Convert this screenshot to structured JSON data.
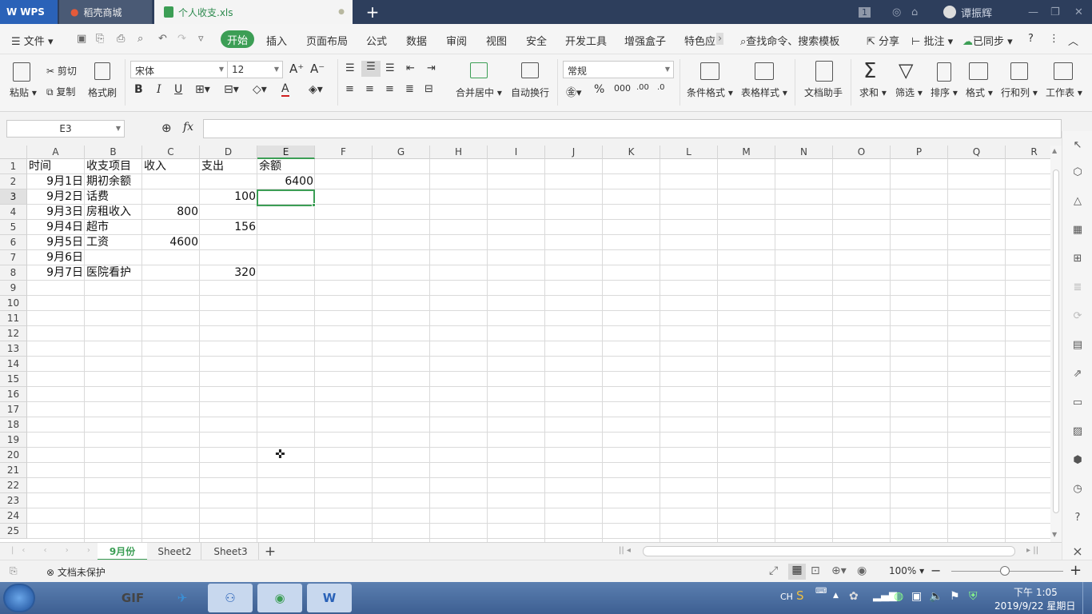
{
  "titlebar": {
    "app_tab": "WPS",
    "store_tab": "稻壳商城",
    "file_tab": "个人收支.xls",
    "new_tab_label": "+",
    "page_indicator": "1",
    "user_name": "谭振辉"
  },
  "menu": {
    "file": "文件",
    "items": [
      "开始",
      "插入",
      "页面布局",
      "公式",
      "数据",
      "审阅",
      "视图",
      "安全",
      "开发工具",
      "增强盒子",
      "特色应"
    ],
    "search": "查找命令、搜索模板",
    "share": "分享",
    "comment": "批注",
    "sync": "已同步"
  },
  "ribbon": {
    "paste": "粘贴",
    "cut": "剪切",
    "copy": "复制",
    "format_painter": "格式刷",
    "font_name": "宋体",
    "font_size": "12",
    "merge_center": "合并居中",
    "wrap_text": "自动换行",
    "number_format": "常规",
    "cond_format": "条件格式",
    "table_style": "表格样式",
    "doc_assistant": "文档助手",
    "sum": "求和",
    "filter": "筛选",
    "sort": "排序",
    "format": "格式",
    "row_col": "行和列",
    "worksheet": "工作表"
  },
  "formula": {
    "cell_ref": "E3",
    "fx": "fx",
    "value": ""
  },
  "columns": [
    "A",
    "B",
    "C",
    "D",
    "E",
    "F",
    "G",
    "H",
    "I",
    "J",
    "K",
    "L",
    "M",
    "N",
    "O",
    "P",
    "Q",
    "R"
  ],
  "selected_column": "E",
  "selected_row": "3",
  "rows": [
    "1",
    "2",
    "3",
    "4",
    "5",
    "6",
    "7",
    "8",
    "9",
    "10",
    "11",
    "12",
    "13",
    "14",
    "15",
    "16",
    "17",
    "18",
    "19",
    "20",
    "21",
    "22",
    "23",
    "24",
    "25"
  ],
  "cells": {
    "headers": [
      "时间",
      "收支项目",
      "收入",
      "支出",
      "余额"
    ],
    "data": [
      {
        "date": "9月1日",
        "item": "期初余额",
        "income": "",
        "expense": "",
        "balance": "6400"
      },
      {
        "date": "9月2日",
        "item": "话费",
        "income": "",
        "expense": "100",
        "balance": ""
      },
      {
        "date": "9月3日",
        "item": "房租收入",
        "income": "800",
        "expense": "",
        "balance": ""
      },
      {
        "date": "9月4日",
        "item": "超市",
        "income": "",
        "expense": "156",
        "balance": ""
      },
      {
        "date": "9月5日",
        "item": "工资",
        "income": "4600",
        "expense": "",
        "balance": ""
      },
      {
        "date": "9月6日",
        "item": "",
        "income": "",
        "expense": "",
        "balance": ""
      },
      {
        "date": "9月7日",
        "item": "医院看护",
        "income": "",
        "expense": "320",
        "balance": ""
      }
    ]
  },
  "sheets": [
    "9月份",
    "Sheet2",
    "Sheet3"
  ],
  "active_sheet": "9月份",
  "status": {
    "protection": "文档未保护",
    "zoom": "100%"
  },
  "taskbar": {
    "lang": "CH",
    "time": "下午 1:05",
    "date": "2019/9/22 星期日"
  },
  "colors": {
    "accent": "#3c9e55",
    "titlebar": "#2d3e5c",
    "taskbar": "#4a6fa5"
  }
}
